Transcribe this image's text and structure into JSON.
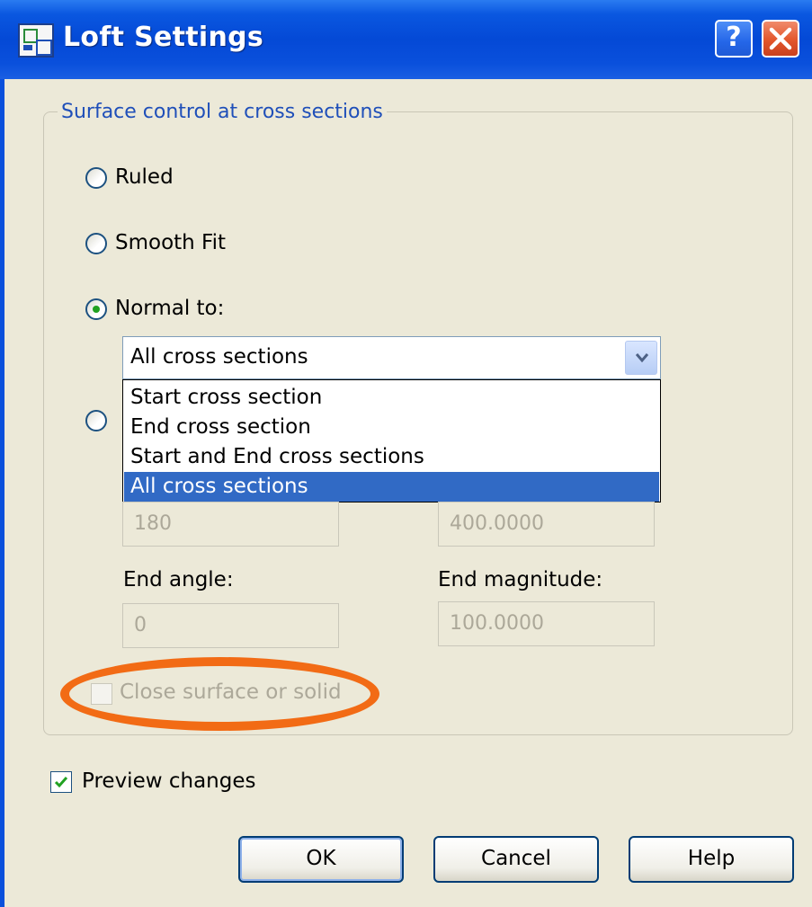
{
  "window": {
    "title": "Loft Settings",
    "app_icon": "autocad-loft-icon",
    "help_button_label": "?",
    "close_icon": "close-icon",
    "colors": {
      "titlebar": "#0449d6",
      "face": "#ece9d8",
      "accent": "#f26b15"
    }
  },
  "surface_control": {
    "legend": "Surface control at cross sections",
    "ruled_label": "Ruled",
    "smooth_fit_label": "Smooth Fit",
    "normal_to_label": "Normal to:",
    "selected_option": "Normal to:",
    "normal_to_combo": {
      "value": "All cross sections",
      "options": [
        "Start cross section",
        "End cross section",
        "Start and End cross sections",
        "All cross sections"
      ],
      "highlighted": "All cross sections"
    },
    "start_angle_value": "180",
    "start_magnitude_value": "400.0000",
    "end_angle_label": "End angle:",
    "end_angle_value": "0",
    "end_magnitude_label": "End magnitude:",
    "end_magnitude_value": "100.0000",
    "close_surface_label": "Close surface or solid",
    "close_surface_checked": false,
    "close_surface_enabled": false
  },
  "preview_changes": {
    "label": "Preview changes",
    "checked": true
  },
  "buttons": {
    "ok": "OK",
    "cancel": "Cancel",
    "help": "Help"
  }
}
